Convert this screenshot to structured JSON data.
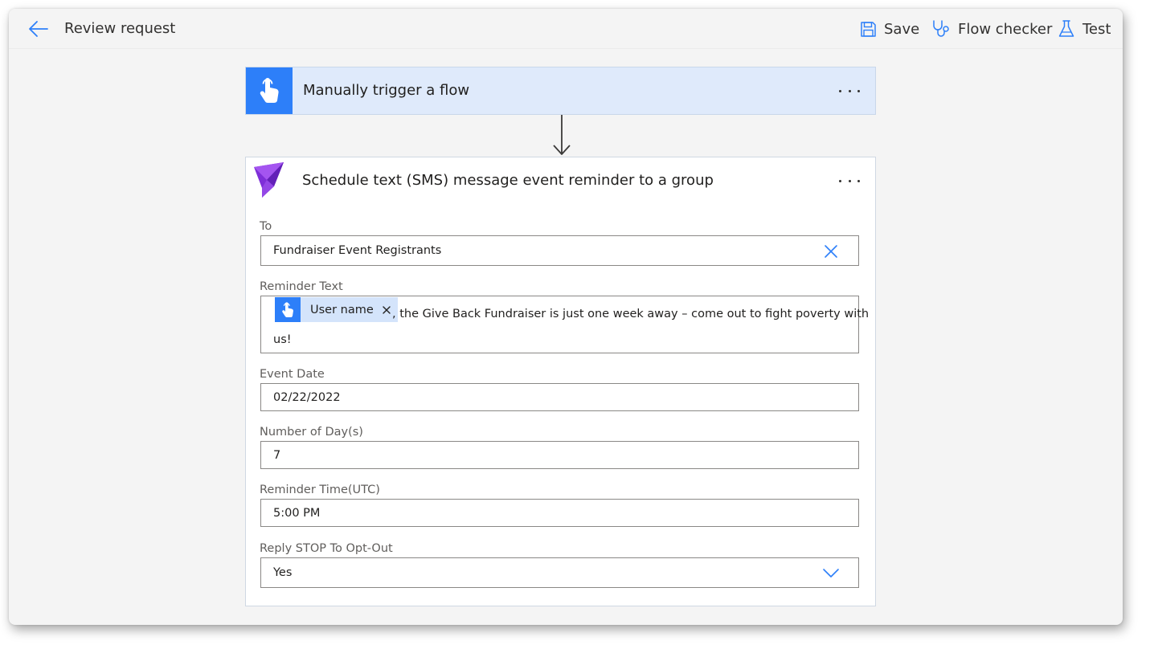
{
  "header": {
    "title": "Review request",
    "actions": {
      "save": "Save",
      "flow_checker": "Flow checker",
      "test": "Test"
    }
  },
  "trigger": {
    "title": "Manually trigger a flow"
  },
  "action": {
    "title": "Schedule text (SMS) message event reminder to a group",
    "fields": {
      "to": {
        "label": "To",
        "value": "Fundraiser Event Registrants"
      },
      "reminder_text": {
        "label": "Reminder Text",
        "token": "User name",
        "text_line1": ", the Give Back Fundraiser is just one week away – come out to fight poverty with",
        "text_line2": "us!"
      },
      "event_date": {
        "label": "Event Date",
        "value": "02/22/2022"
      },
      "days": {
        "label": "Number of Day(s)",
        "value": "7"
      },
      "reminder_time": {
        "label": "Reminder Time(UTC)",
        "value": "5:00 PM"
      },
      "opt_out": {
        "label": "Reply STOP To Opt-Out",
        "value": "Yes"
      }
    }
  },
  "colors": {
    "accent": "#2d7ff9",
    "trigger_bg": "#dfeafb",
    "token_bg": "#d4e4fb",
    "connector_icon": "#8a2be2"
  }
}
